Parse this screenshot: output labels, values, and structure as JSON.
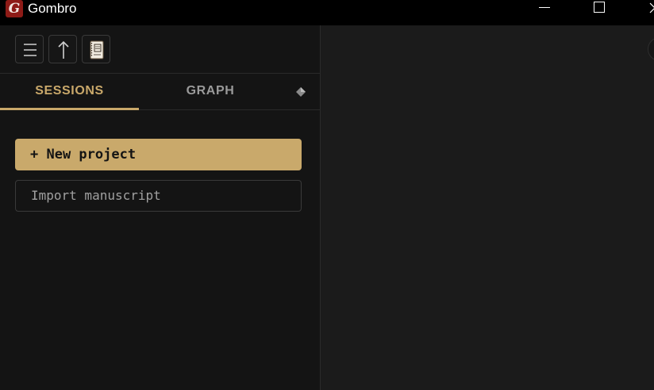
{
  "window": {
    "title": "Gombro",
    "logo_letter": "G"
  },
  "toolbar": {
    "buttons": [
      {
        "name": "menu",
        "icon": "hamburger-icon"
      },
      {
        "name": "up",
        "icon": "arrow-up-icon"
      },
      {
        "name": "notebook",
        "icon": "notebook-icon"
      }
    ]
  },
  "tabs": [
    {
      "label": "SESSIONS",
      "active": true
    },
    {
      "label": "GRAPH",
      "active": false
    }
  ],
  "actions": {
    "new_project": "+ New project",
    "import_manuscript": "Import manuscript"
  },
  "colors": {
    "accent": "#c9a96b",
    "panel_bg": "#141414",
    "main_bg": "#1b1b1b",
    "title_bar": "#000000",
    "logo": "#8e1b17"
  }
}
